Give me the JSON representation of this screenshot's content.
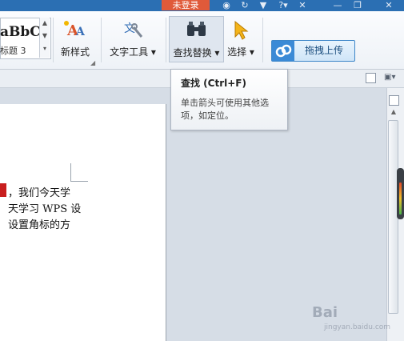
{
  "title_bar": {
    "login_label": "未登录",
    "icons": [
      "shirt-icon",
      "help-icon",
      "minimize-icon",
      "close-icon"
    ]
  },
  "ribbon": {
    "style_sample": "aBbC",
    "style_name": "标题 3",
    "new_style_label": "新样式",
    "text_tools_label": "文字工具",
    "find_replace_label": "查找替换",
    "select_label": "选择",
    "upload_label": "拖拽上传"
  },
  "tooltip": {
    "title": "查找 (Ctrl+F)",
    "body": "单击箭头可使用其他选项，如定位。"
  },
  "document": {
    "lines": [
      "，我们今天学",
      "天学习 WPS 设",
      "设置角标的方"
    ]
  },
  "watermark": {
    "text": "Bai",
    "sub_text": "jingyan.baidu.com"
  },
  "colors": {
    "title_bar": "#2b6fb3",
    "login_badge": "#e05a3a",
    "upload_accent": "#3b8ad6",
    "highlight_mark": "#c81e1e"
  }
}
